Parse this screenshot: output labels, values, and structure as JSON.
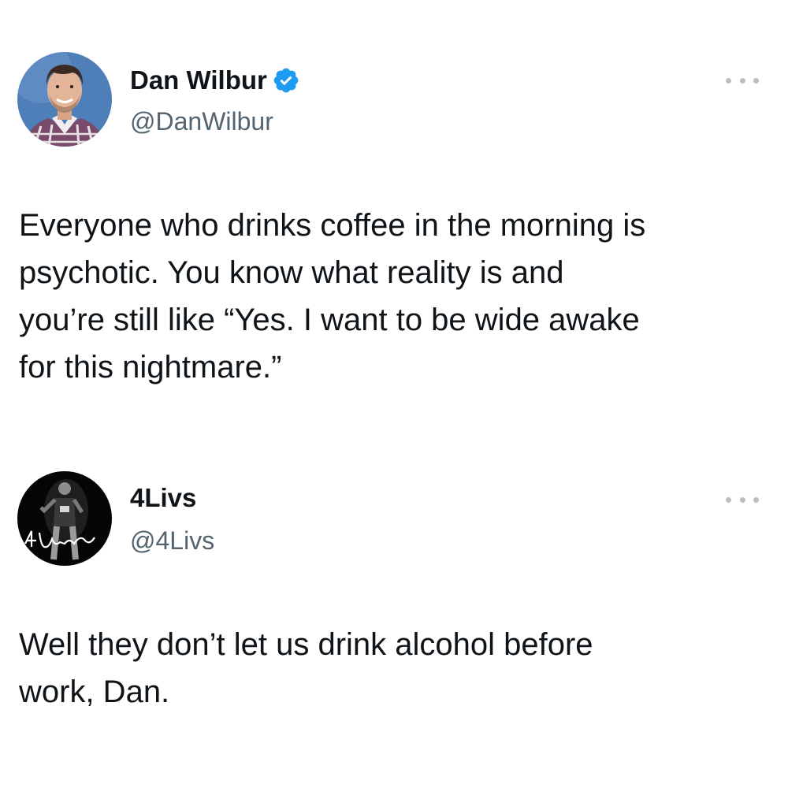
{
  "tweets": [
    {
      "display_name": "Dan Wilbur",
      "handle": "@DanWilbur",
      "verified": true,
      "avatar_icon": "person-portrait-avatar",
      "text": "Everyone who drinks coffee in the morning is\npsychotic. You know what reality is and\nyou’re still like “Yes. I want to be wide awake\nfor this nightmare.”"
    },
    {
      "display_name": "4Livs",
      "handle": "@4Livs",
      "verified": false,
      "avatar_icon": "performer-avatar",
      "avatar_logo_text": "4Livs",
      "text": "Well they don’t let us drink alcohol before\nwork, Dan."
    }
  ],
  "colors": {
    "text_primary": "#0f1419",
    "text_secondary": "#536471",
    "verified_blue": "#1d9bf0",
    "more_dots": "#b8c0c6",
    "background": "#ffffff"
  },
  "icons": {
    "verified": "verified-badge-icon",
    "more": "more-options-icon"
  }
}
